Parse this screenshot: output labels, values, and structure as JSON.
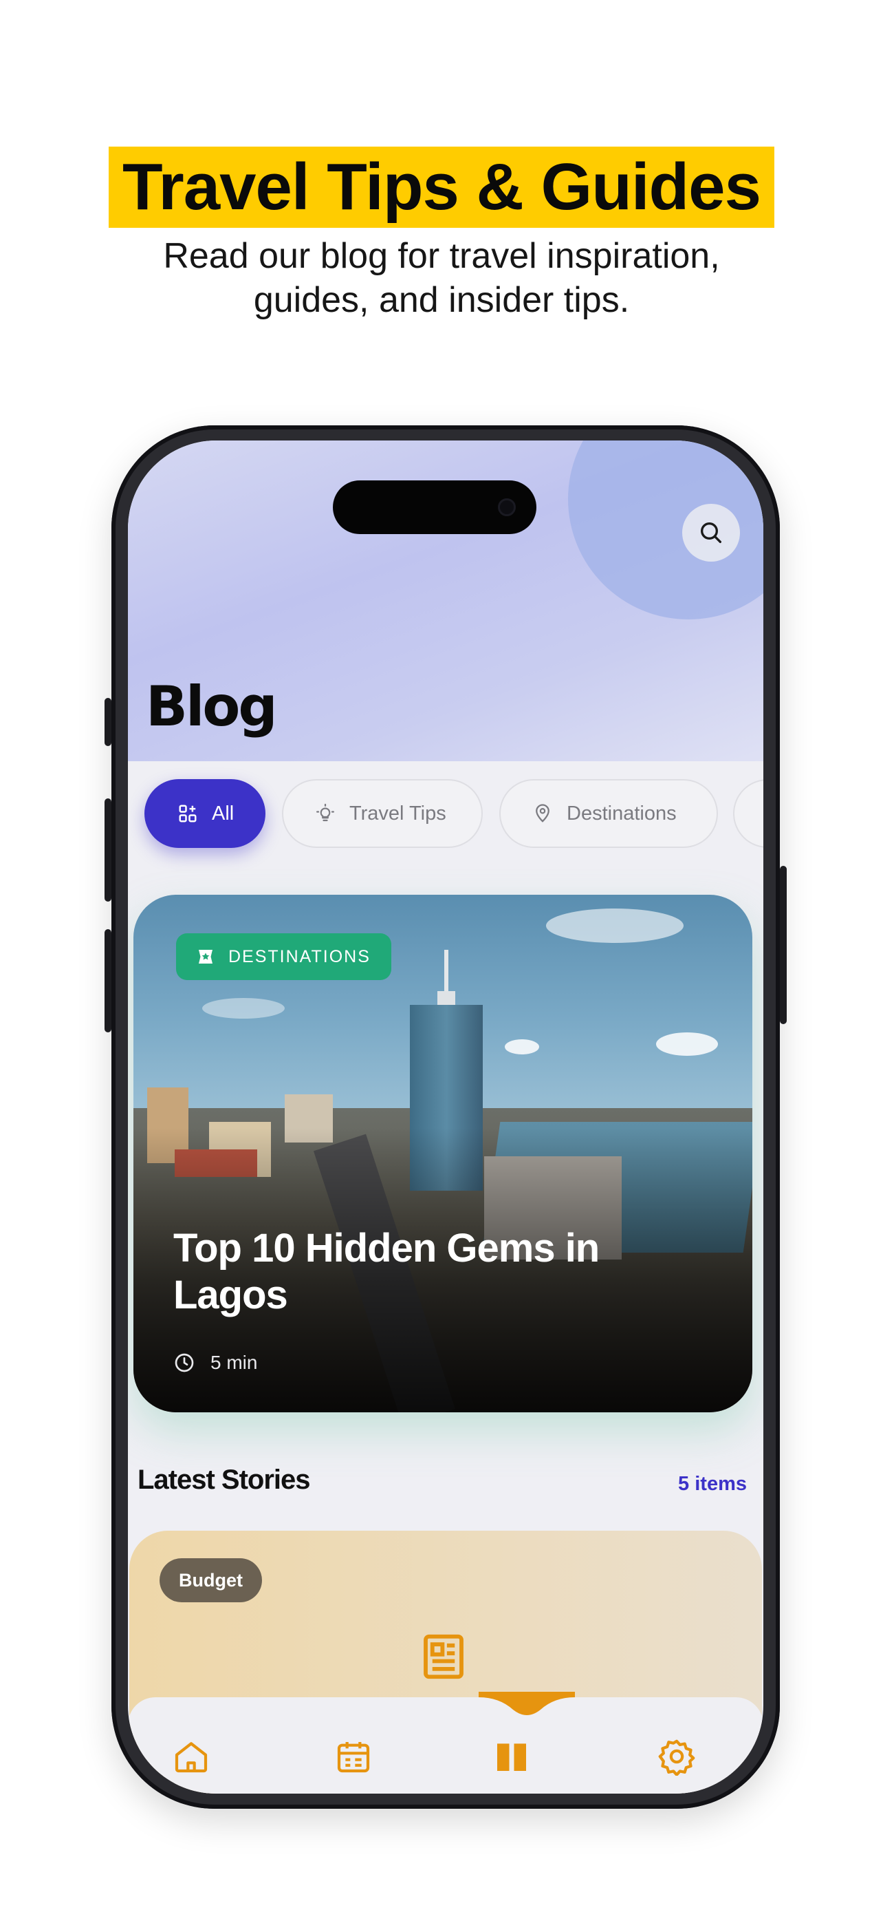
{
  "promo": {
    "title": "Travel Tips & Guides",
    "subtitle_line1": "Read our blog for travel inspiration,",
    "subtitle_line2": "guides, and insider tips."
  },
  "app": {
    "page_title": "Blog",
    "search_icon": "search-icon"
  },
  "filters": [
    {
      "label": "All",
      "icon": "grid-icon",
      "active": true
    },
    {
      "label": "Travel Tips",
      "icon": "lightbulb-icon",
      "active": false
    },
    {
      "label": "Destinations",
      "icon": "location-pin-icon",
      "active": false
    }
  ],
  "featured": {
    "category": "DESTINATIONS",
    "category_icon": "star-badge-icon",
    "title": "Top 10 Hidden Gems in Lagos",
    "read_time": "5 min",
    "read_time_icon": "clock-icon"
  },
  "latest": {
    "title": "Latest Stories",
    "count": "5 items",
    "stories": [
      {
        "tag": "Budget",
        "icon": "article-icon"
      }
    ]
  },
  "nav": [
    {
      "name": "home",
      "icon": "home-icon"
    },
    {
      "name": "calendar",
      "icon": "calendar-icon"
    },
    {
      "name": "blog",
      "icon": "book-icon",
      "active": true
    },
    {
      "name": "settings",
      "icon": "gear-icon"
    }
  ],
  "colors": {
    "accent": "#3c32c8",
    "highlight": "#ffcc00",
    "badge_green": "#20a978",
    "nav_orange": "#e6940f"
  }
}
